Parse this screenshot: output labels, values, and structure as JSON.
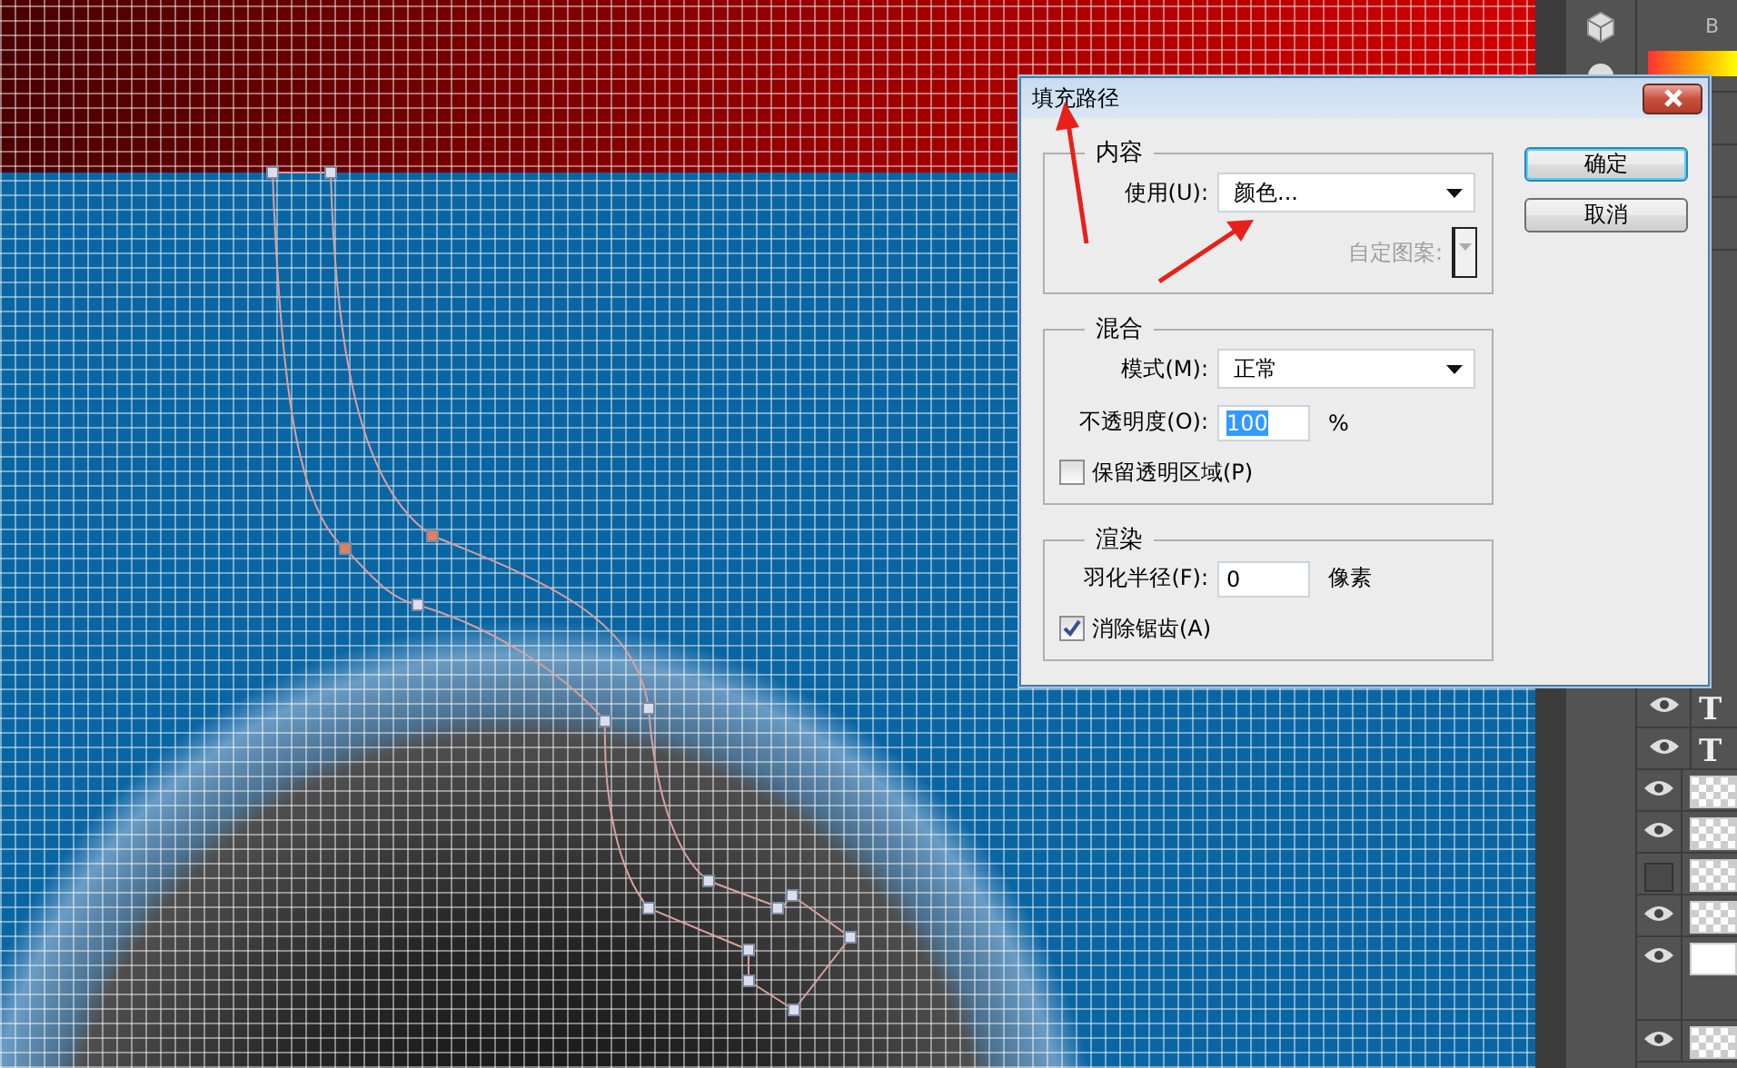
{
  "dialog": {
    "title": "填充路径",
    "sections": [
      {
        "legend": "内容",
        "rows": [
          {
            "kind": "select",
            "label": "使用(U):",
            "value": "颜色...",
            "disabled": false
          },
          {
            "kind": "pattern",
            "label": "自定图案:",
            "disabled": true
          }
        ]
      },
      {
        "legend": "混合",
        "rows": [
          {
            "kind": "select",
            "label": "模式(M):",
            "value": "正常",
            "disabled": false
          },
          {
            "kind": "input",
            "label": "不透明度(O):",
            "value": "100",
            "unit": "%",
            "highlighted": true
          },
          {
            "kind": "checkbox",
            "label": "保留透明区域(P)",
            "checked": false
          }
        ]
      },
      {
        "legend": "渲染",
        "rows": [
          {
            "kind": "input",
            "label": "羽化半径(F):",
            "value": "0",
            "unit": "像素",
            "highlighted": false
          },
          {
            "kind": "checkbox",
            "label": "消除锯齿(A)",
            "checked": true
          }
        ]
      }
    ],
    "buttons": [
      {
        "label": "确定",
        "default": true
      },
      {
        "label": "取消",
        "default": false
      }
    ]
  },
  "panel": {
    "header": "B",
    "layers": [
      {
        "kind": "text",
        "glyph": "T",
        "visible": true
      },
      {
        "kind": "text",
        "glyph": "T",
        "visible": true
      },
      {
        "kind": "image",
        "visible": true
      },
      {
        "kind": "image",
        "visible": true
      },
      {
        "kind": "image",
        "visible": false
      },
      {
        "kind": "image",
        "visible": true
      },
      {
        "kind": "group",
        "visible": true
      },
      {
        "kind": "image",
        "visible": true
      }
    ]
  }
}
